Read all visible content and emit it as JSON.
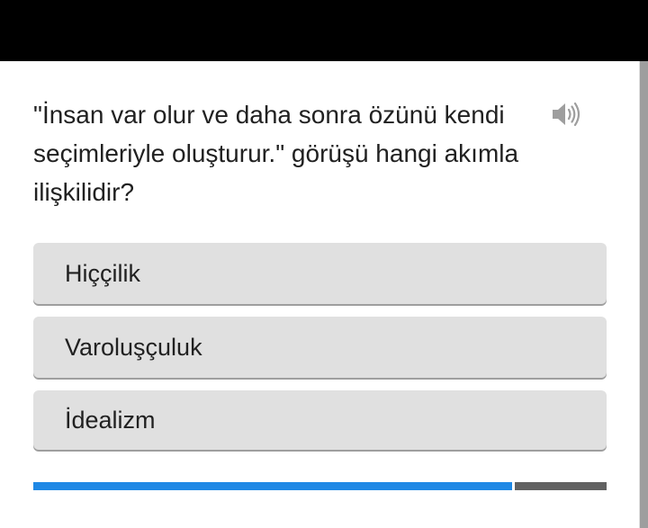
{
  "question": {
    "text": "\"İnsan var olur ve daha sonra özünü kendi seçimleriyle oluşturur.\" görüşü hangi akımla ilişkilidir?",
    "audio_icon": "speaker-icon"
  },
  "options": [
    {
      "label": "Hiççilik"
    },
    {
      "label": "Varoluşçuluk"
    },
    {
      "label": "İdealizm"
    }
  ],
  "progress": {
    "fraction": 0.835
  },
  "colors": {
    "progress_fill": "#1e88e5",
    "progress_rest": "#616161",
    "option_bg": "#e0e0e0",
    "top_bar": "#000000"
  }
}
